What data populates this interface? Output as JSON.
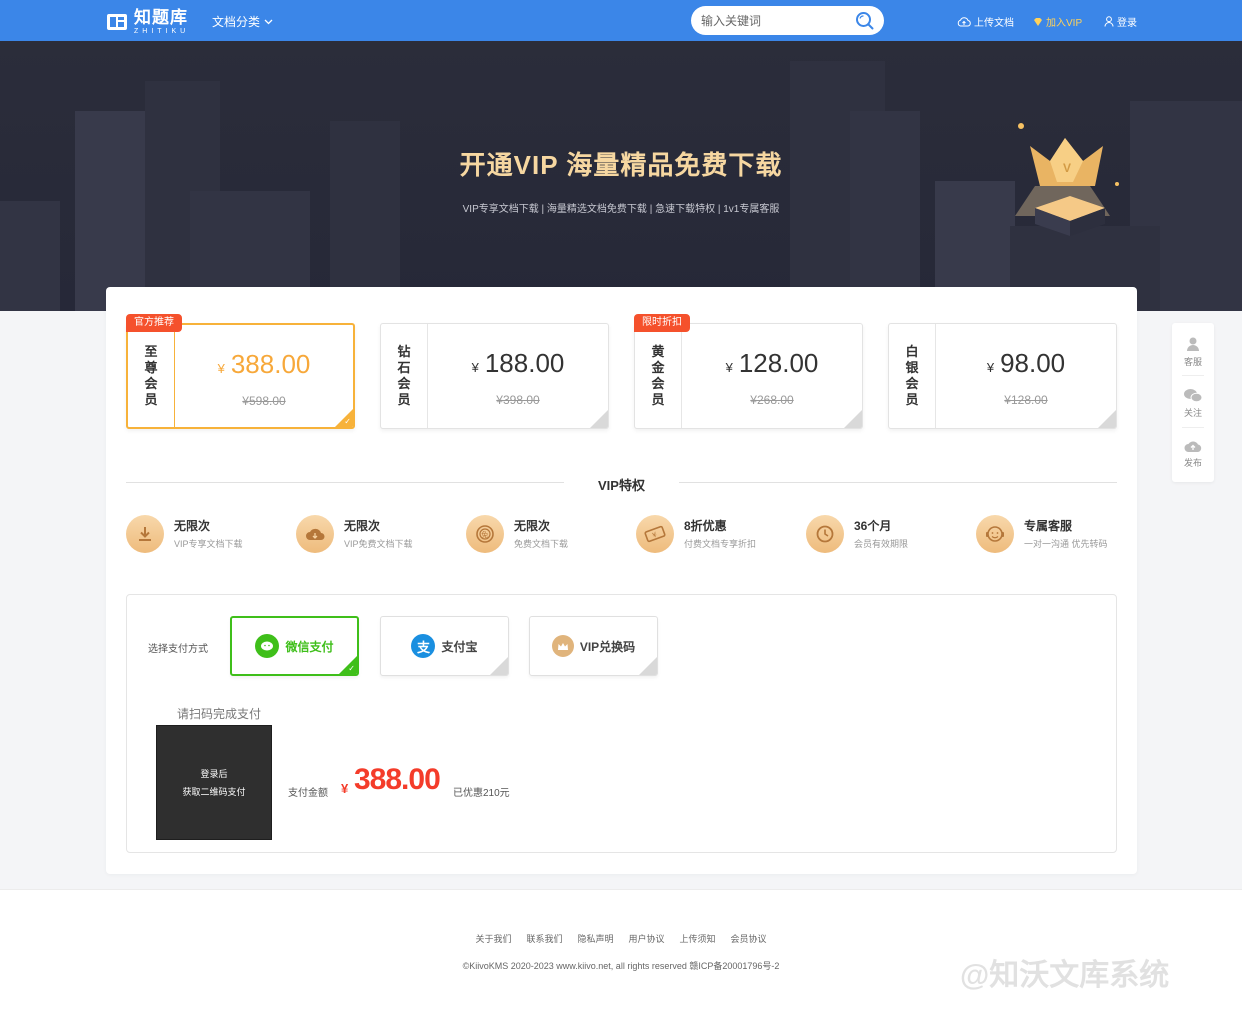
{
  "header": {
    "logo_cn": "知题库",
    "logo_en": "ZHITIKU",
    "doc_category": "文档分类",
    "search_placeholder": "输入关键词",
    "upload": "上传文档",
    "join_vip": "加入VIP",
    "login": "登录"
  },
  "banner": {
    "title": "开通VIP 海量精品免费下载",
    "subtitle": "VIP专享文档下载 | 海量精选文档免费下载 | 急速下载特权 | 1v1专属客服"
  },
  "plans": [
    {
      "name": [
        "至",
        "尊",
        "会",
        "员"
      ],
      "price": "388.00",
      "original": "¥598.00",
      "tag": "官方推荐",
      "selected": true
    },
    {
      "name": [
        "钻",
        "石",
        "会",
        "员"
      ],
      "price": "188.00",
      "original": "¥398.00",
      "tag": "",
      "selected": false
    },
    {
      "name": [
        "黄",
        "金",
        "会",
        "员"
      ],
      "price": "128.00",
      "original": "¥268.00",
      "tag": "限时折扣",
      "selected": false
    },
    {
      "name": [
        "白",
        "银",
        "会",
        "员"
      ],
      "price": "98.00",
      "original": "¥128.00",
      "tag": "",
      "selected": false
    }
  ],
  "currency_symbol": "¥",
  "privileges_title": "VIP特权",
  "privileges": [
    {
      "title": "无限次",
      "desc": "VIP专享文档下载",
      "icon": "download-icon"
    },
    {
      "title": "无限次",
      "desc": "VIP免费文档下载",
      "icon": "cloud-download-icon"
    },
    {
      "title": "无限次",
      "desc": "免费文档下载",
      "icon": "free-badge-icon"
    },
    {
      "title": "8折优惠",
      "desc": "付费文档专享折扣",
      "icon": "coupon-icon"
    },
    {
      "title": "36个月",
      "desc": "会员有效期限",
      "icon": "clock-icon"
    },
    {
      "title": "专属客服",
      "desc": "一对一沟通 优先转码",
      "icon": "headset-icon"
    }
  ],
  "payment": {
    "label": "选择支付方式",
    "methods": [
      {
        "label": "微信支付",
        "icon": "wechat-pay-icon",
        "selected": true
      },
      {
        "label": "支付宝",
        "icon": "alipay-icon",
        "selected": false
      },
      {
        "label": "VIP兑换码",
        "icon": "vip-crown-icon",
        "selected": false
      }
    ],
    "scan_tip": "请扫码完成支付",
    "qr_line1": "登录后",
    "qr_line2": "获取二维码支付",
    "amount_label": "支付金额",
    "amount_value": "388.00",
    "saved": "已优惠210元"
  },
  "float_bar": [
    {
      "label": "客服",
      "icon": "user-service-icon"
    },
    {
      "label": "关注",
      "icon": "wechat-icon"
    },
    {
      "label": "发布",
      "icon": "cloud-upload-icon"
    }
  ],
  "footer": {
    "links": [
      "关于我们",
      "联系我们",
      "隐私声明",
      "用户协议",
      "上传须知",
      "会员协议"
    ],
    "copyright": "©KiivoKMS 2020-2023 www.kiivo.net, all rights reserved 赣ICP备20001796号-2"
  },
  "watermark": "@知沃文库系统",
  "colors": {
    "primary": "#3b86e8",
    "gold": "#f7b23a",
    "red": "#f5512c",
    "wechat": "#3fbf1a"
  }
}
